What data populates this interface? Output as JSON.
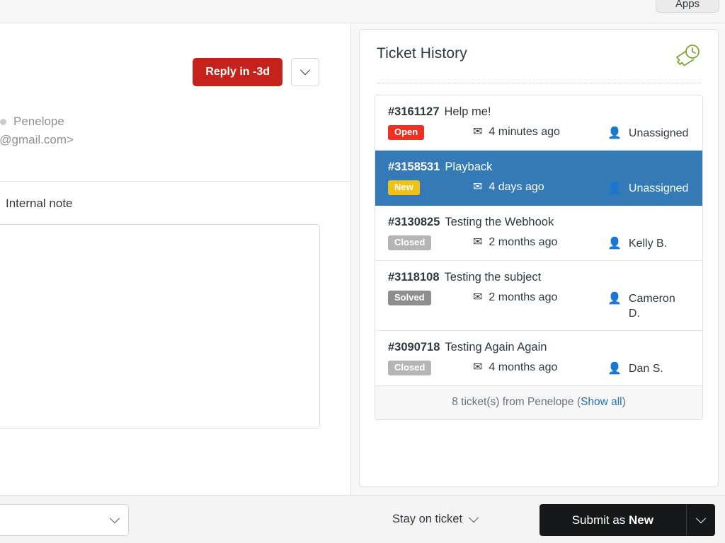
{
  "topbar": {
    "apps_label": "Apps"
  },
  "composer": {
    "reply_button_label": "Reply in -3d",
    "reply_dropdown_icon": "chevron-down-icon",
    "requester_name": "Penelope",
    "requester_email_clipped": "wesome@gmail.com>",
    "internal_note_label": "Internal note",
    "note_value": "",
    "note_placeholder": ""
  },
  "sidebar": {
    "title": "Ticket History",
    "header_icon": "ticket-clock-icon",
    "tickets": [
      {
        "id": "#3161127",
        "subject": "Help me!",
        "status": "Open",
        "status_kind": "open",
        "time": "4 minutes ago",
        "assignee": "Unassigned",
        "selected": false
      },
      {
        "id": "#3158531",
        "subject": "Playback",
        "status": "New",
        "status_kind": "new",
        "time": "4 days ago",
        "assignee": "Unassigned",
        "selected": true
      },
      {
        "id": "#3130825",
        "subject": "Testing the Webhook",
        "status": "Closed",
        "status_kind": "closed",
        "time": "2 months ago",
        "assignee": "Kelly B.",
        "selected": false
      },
      {
        "id": "#3118108",
        "subject": "Testing the subject",
        "status": "Solved",
        "status_kind": "solved",
        "time": "2 months ago",
        "assignee": "Cameron D.",
        "selected": false
      },
      {
        "id": "#3090718",
        "subject": "Testing Again Again",
        "status": "Closed",
        "status_kind": "closed",
        "time": "4 months ago",
        "assignee": "Dan S.",
        "selected": false
      }
    ],
    "footer_prefix": "8 ticket(s) from Penelope (",
    "footer_link": "Show all",
    "footer_suffix": ")"
  },
  "bottombar": {
    "macro_select_value": "",
    "macro_select_icon": "chevron-down-icon",
    "stay_on_ticket_label": "Stay on ticket",
    "stay_on_ticket_icon": "chevron-down-icon",
    "submit_prefix": "Submit as ",
    "submit_status": "New",
    "submit_dropdown_icon": "chevron-down-icon"
  },
  "colors": {
    "selected_row": "#337ab7",
    "badge_open": "#ee3124",
    "badge_new": "#f2c118",
    "badge_closed": "#b5b5b5",
    "badge_solved": "#8e8e8e",
    "reply_button": "#c5221b",
    "submit_button": "#17181a",
    "link": "#1f73b7",
    "header_icon": "#7aa72e"
  }
}
